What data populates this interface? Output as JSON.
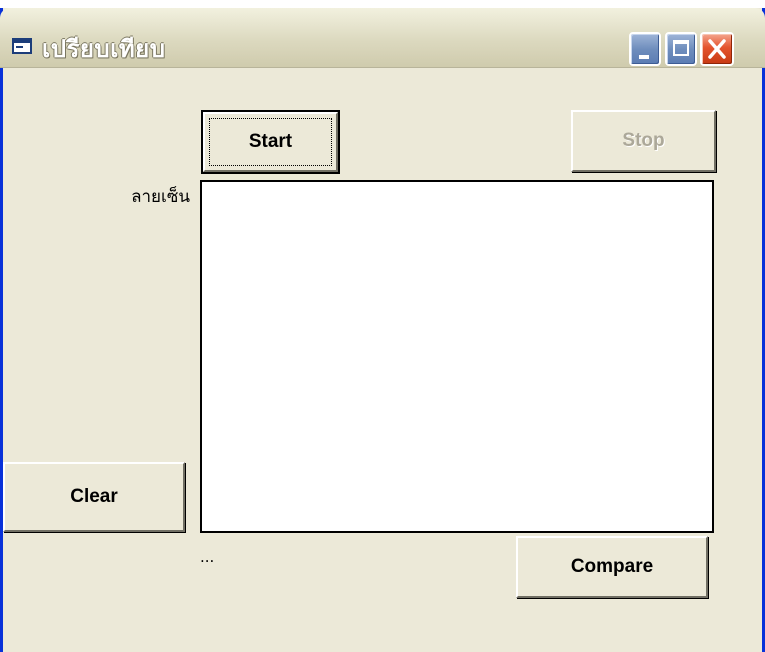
{
  "window": {
    "title": "เปรียบเทียบ",
    "icon": "form-icon"
  },
  "caption_buttons": {
    "minimize": "minimize-icon",
    "maximize": "maximize-icon",
    "close": "close-icon"
  },
  "buttons": {
    "start_label": "Start",
    "stop_label": "Stop",
    "clear_label": "Clear",
    "compare_label": "Compare"
  },
  "signature": {
    "label": "ลายเซ็น"
  },
  "status": {
    "text": "..."
  },
  "colors": {
    "face": "#ece9d8",
    "frame_blue": "#0831d9",
    "close_red": "#e4532d",
    "disabled_text": "#aca899"
  }
}
